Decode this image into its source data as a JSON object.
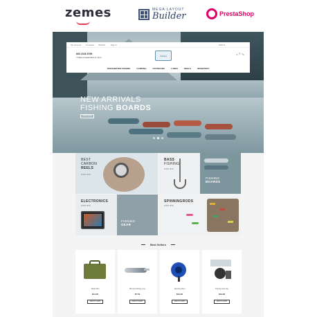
{
  "brands": {
    "zemes": "zemes",
    "mega_small": "MEGA LAYOUT",
    "mega_big": "Builder",
    "prestashop": "PrestaShop"
  },
  "header": {
    "top_links": [
      "My account",
      "Compare",
      "Wishlist",
      "Sign in"
    ],
    "currency": "USD $",
    "phone": "800 2345 6789",
    "address": "7 Days a week 9am to 7pm",
    "logo_text": "Fishing",
    "icons": "⌕ ♡ ⛍",
    "nav": [
      "FRESHWATER FISHING",
      "CAMPING",
      "OUTDOORS",
      "LURES",
      "REELS",
      "INVENTORY"
    ]
  },
  "hero": {
    "line1": "NEW ARRIVALS",
    "line2_prefix": "FISHING ",
    "line2_bold": "BOARDS",
    "button": "SHOP NOW",
    "slides": 3,
    "active_slide": 2
  },
  "tiles": [
    {
      "line1": "BEST",
      "line2": "CARBON",
      "line3": "REELS",
      "sub": "SHOP NOW"
    },
    {
      "line1": "BASS",
      "line2": "FISHING",
      "line3": "BOARDS",
      "sub": "SHOP NOW"
    },
    {
      "line1": "ELECTRONICS",
      "line2": "",
      "line3": "",
      "sub": "SHOP NOW"
    },
    {
      "line1": "SPINNINGRODS",
      "line2": "",
      "line3": "",
      "sub": "SHOP NOW"
    }
  ],
  "tile_extra": {
    "fishing_gear_1": "FISHING",
    "fishing_gear_2": "GEAR",
    "fishing_boards_1": "FISHING",
    "fishing_boards_2": "BOARDS"
  },
  "best_sellers": {
    "title": "Best Sellers",
    "products": [
      {
        "name": "Tackle Box",
        "price": "$14.20",
        "button": "ADD TO CART"
      },
      {
        "name": "Minnow Fishing Lure",
        "price": "$7.50",
        "button": "ADD TO CART"
      },
      {
        "name": "Spinning Reel",
        "price": "$24.90",
        "button": "ADD TO CART"
      },
      {
        "name": "Fishing Gear Set",
        "price": "$19.99",
        "button": "ADD TO CART"
      }
    ]
  }
}
